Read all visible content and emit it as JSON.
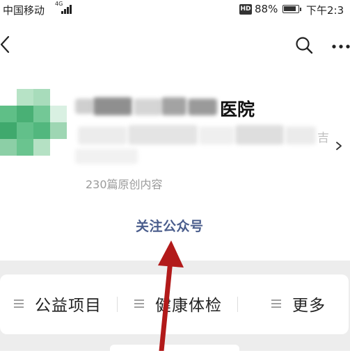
{
  "status_bar": {
    "carrier": "中国移动",
    "network": "4G",
    "hd_badge": "HD",
    "battery_percent": "88%",
    "battery_level": 0.88,
    "time": "下午2:3"
  },
  "nav": {
    "back_icon": "chevron-left-icon",
    "search_icon": "search-icon",
    "more_icon": "more-horizontal-icon"
  },
  "profile": {
    "account_name_visible": "医院",
    "description_visible_tail": "吉",
    "article_count": "230篇原创内容",
    "follow_button": "关注公众号"
  },
  "menu": {
    "items": [
      {
        "label": "公益项目",
        "icon": "menu-lines-icon"
      },
      {
        "label": "健康体检",
        "icon": "menu-lines-icon"
      },
      {
        "label": "更多",
        "icon": "menu-lines-icon"
      }
    ]
  },
  "colors": {
    "follow_link": "#4a5d8c",
    "arrow_annotation": "#b21a1a",
    "band_gray": "#ededed",
    "avatar_green": "#5fbf87"
  }
}
